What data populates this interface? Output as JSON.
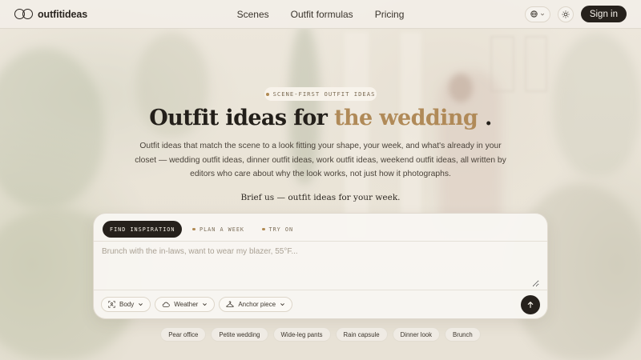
{
  "brand": {
    "name": "outfitideas"
  },
  "nav": [
    {
      "label": "Scenes"
    },
    {
      "label": "Outfit formulas"
    },
    {
      "label": "Pricing"
    }
  ],
  "header": {
    "signin_label": "Sign in",
    "language_icon": "globe-icon",
    "theme_icon": "sun-icon"
  },
  "hero": {
    "tag": "SCENE-FIRST OUTFIT IDEAS",
    "headline_prefix": "Outfit ideas for",
    "headline_accent": "the wedding",
    "headline_suffix": ".",
    "subtext": "Outfit ideas that match the scene to a look fitting your shape, your week, and what's already in your closet — wedding outfit ideas, dinner outfit ideas, work outfit ideas, weekend outfit ideas, all written by editors who care about why the look works, not just how it photographs.",
    "brief": "Brief us — outfit ideas for your week."
  },
  "composer": {
    "tabs": [
      {
        "label": "FIND INSPIRATION",
        "active": true
      },
      {
        "label": "PLAN A WEEK",
        "active": false
      },
      {
        "label": "TRY ON",
        "active": false
      }
    ],
    "placeholder": "Brunch with the in-laws, want to wear my blazer, 55°F...",
    "chips": [
      {
        "label": "Body",
        "icon": "body-scan-icon"
      },
      {
        "label": "Weather",
        "icon": "cloud-icon"
      },
      {
        "label": "Anchor piece",
        "icon": "hanger-icon"
      }
    ],
    "send_icon": "arrow-up-icon"
  },
  "suggestions": [
    "Pear office",
    "Petite wedding",
    "Wide-leg pants",
    "Rain capsule",
    "Dinner look",
    "Brunch"
  ],
  "colors": {
    "accent": "#b08a58",
    "dark": "#26211c",
    "background": "#e9e4d9"
  }
}
